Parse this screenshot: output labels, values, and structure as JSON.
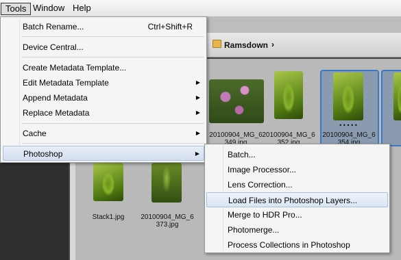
{
  "menubar": {
    "items": [
      {
        "label": "Tools"
      },
      {
        "label": "Window"
      },
      {
        "label": "Help"
      }
    ]
  },
  "breadcrumb": {
    "folder": "Ramsdown",
    "chevron": "›"
  },
  "thumbnails": {
    "captions": [
      "20100904_MG_6 349.jpg",
      "20100904_MG_6 352.jpg",
      "20100904_MG_6 354.jpg",
      "Stack1.jpg",
      "20100904_MG_6 373.jpg"
    ],
    "rating_dots": "• • • • •"
  },
  "tools_menu": {
    "items": [
      {
        "label": "Batch Rename...",
        "shortcut": "Ctrl+Shift+R"
      },
      {
        "label": "Device Central..."
      },
      {
        "label": "Create Metadata Template..."
      },
      {
        "label": "Edit Metadata Template",
        "submenu": true
      },
      {
        "label": "Append Metadata",
        "submenu": true
      },
      {
        "label": "Replace Metadata",
        "submenu": true
      },
      {
        "label": "Cache",
        "submenu": true
      },
      {
        "label": "Photoshop",
        "submenu": true,
        "highlighted": true
      }
    ],
    "arrow_glyph": "▶"
  },
  "photoshop_submenu": {
    "items": [
      {
        "label": "Batch..."
      },
      {
        "label": "Image Processor..."
      },
      {
        "label": "Lens Correction..."
      },
      {
        "label": "Load Files into Photoshop Layers...",
        "highlighted": true
      },
      {
        "label": "Merge to HDR Pro..."
      },
      {
        "label": "Photomerge..."
      },
      {
        "label": "Process Collections in Photoshop"
      }
    ]
  },
  "colors": {
    "selection_border": "#3b78c4",
    "menu_bg": "#f5f5f5",
    "highlight_border": "#a9c0df"
  }
}
